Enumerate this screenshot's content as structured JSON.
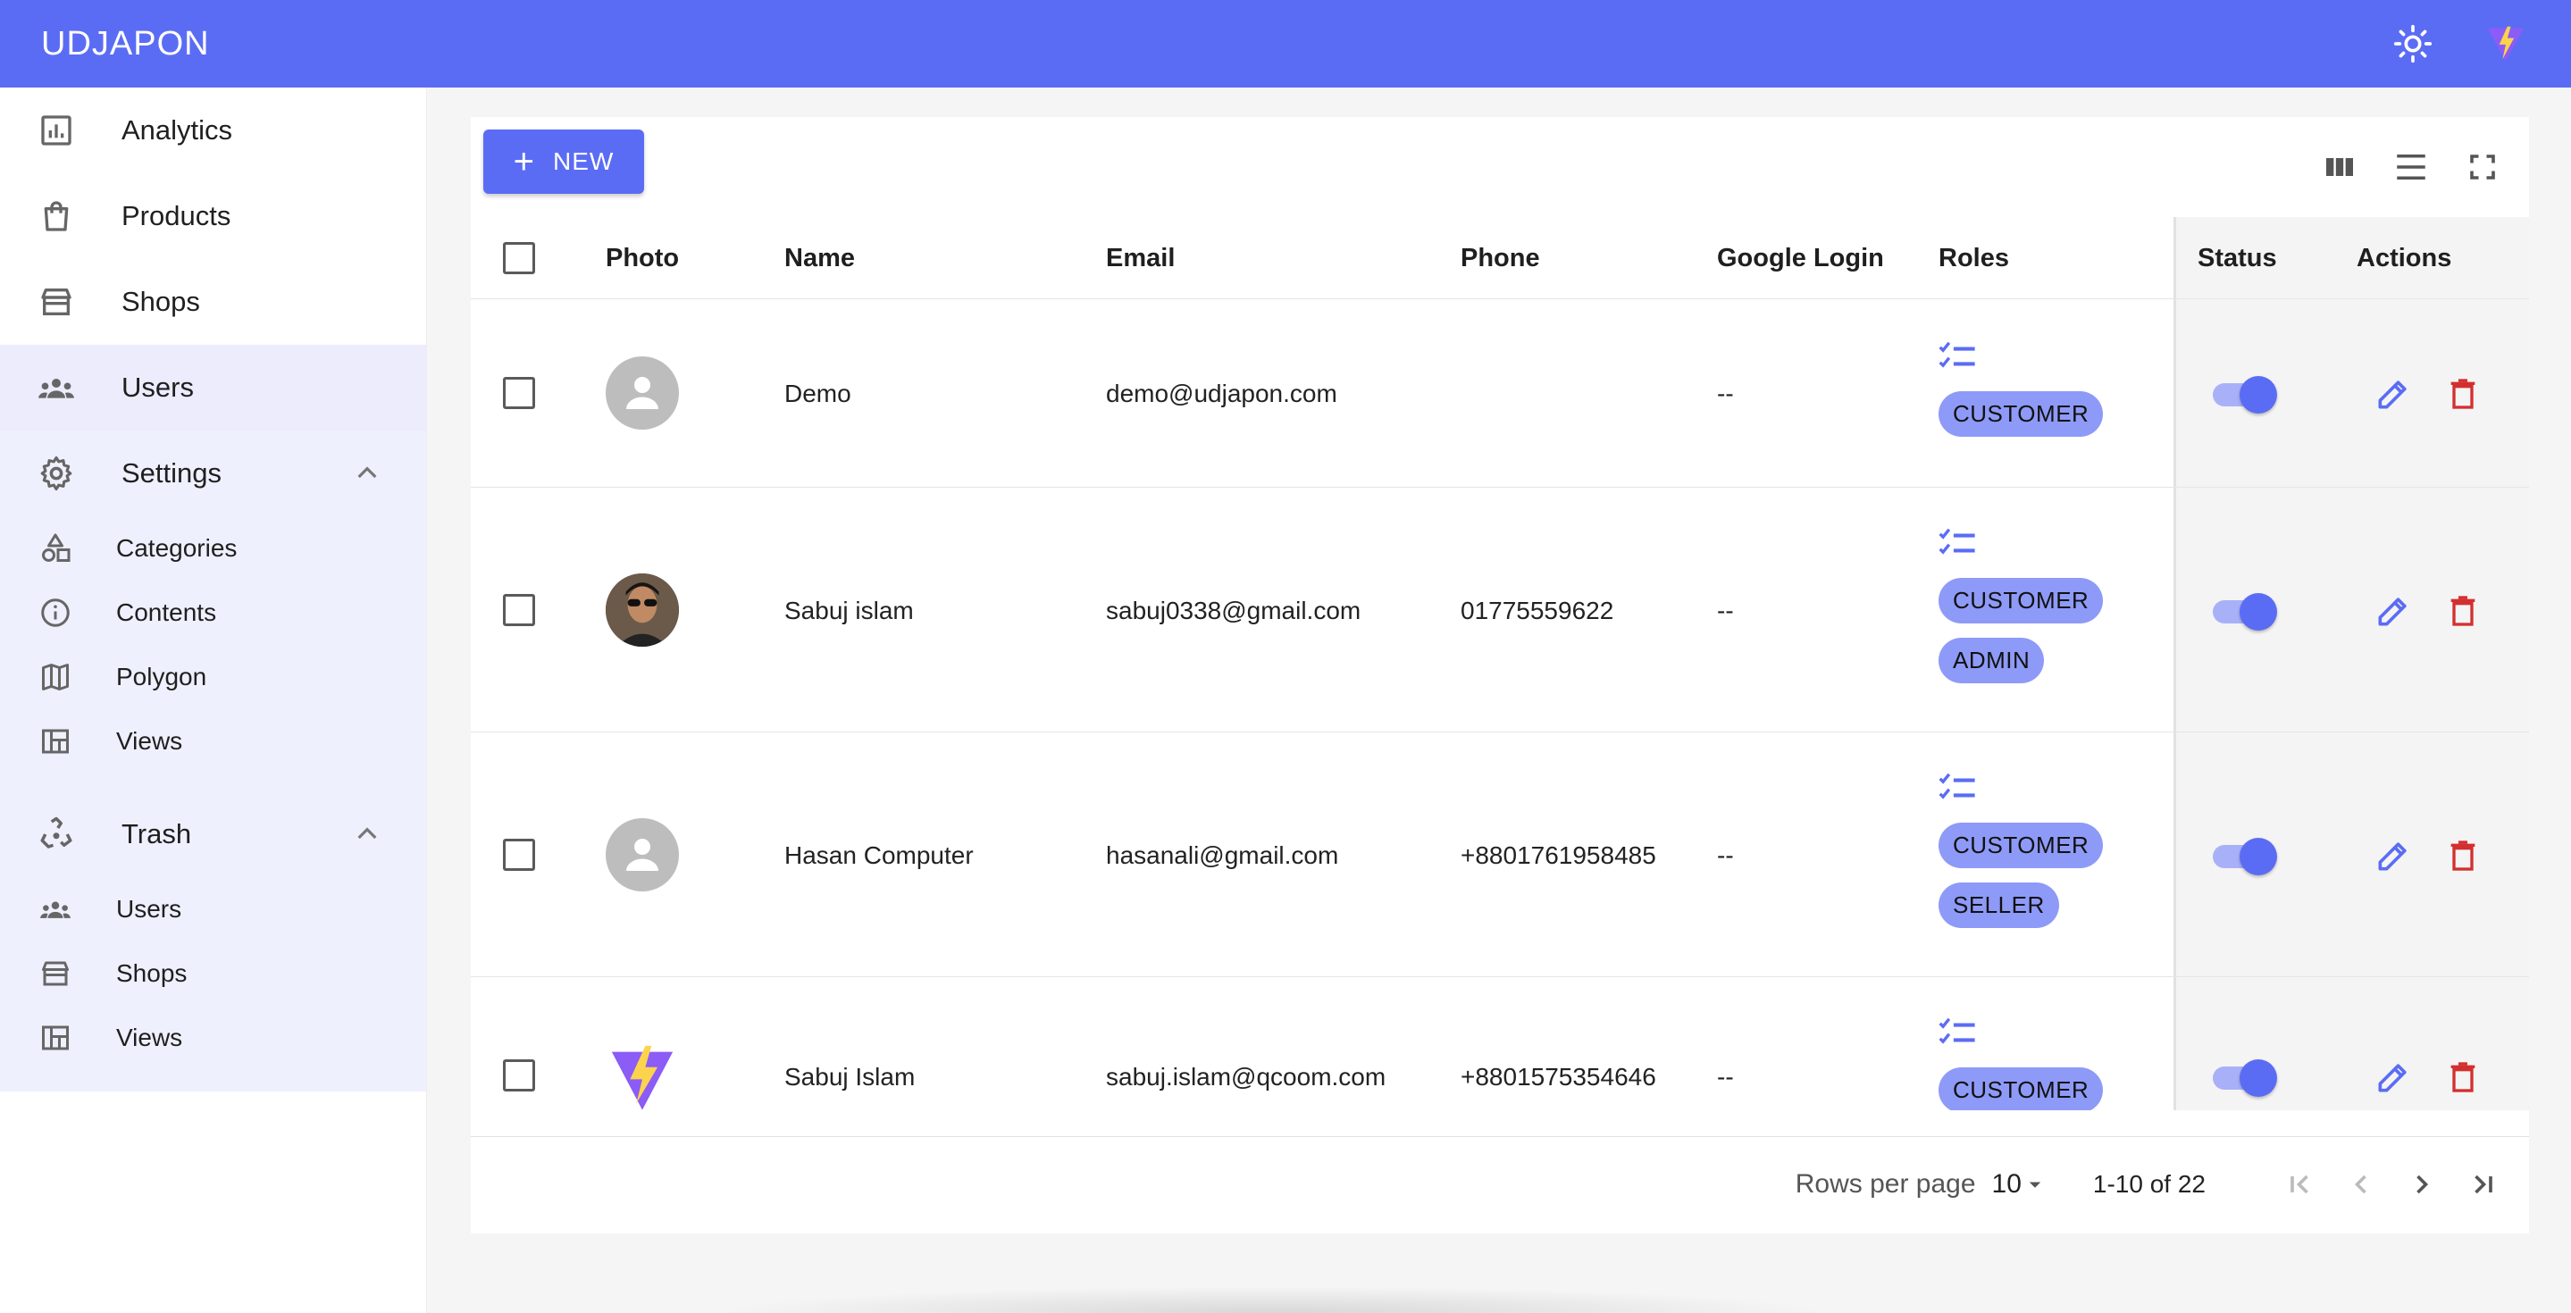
{
  "app": {
    "title": "UDJAPON",
    "header_icons": [
      "sun-icon",
      "vite-logo-icon"
    ],
    "colors": {
      "primary": "#5b6cf4",
      "chip": "#8e9af7",
      "danger": "#d32f2f",
      "sidebar_group_bg": "#eef0fd"
    }
  },
  "sidebar": {
    "items": [
      {
        "label": "Analytics",
        "icon": "analytics-icon"
      },
      {
        "label": "Products",
        "icon": "shopping-bag-icon"
      },
      {
        "label": "Shops",
        "icon": "store-icon"
      },
      {
        "label": "Users",
        "icon": "users-icon"
      }
    ],
    "settings": {
      "label": "Settings",
      "icon": "gear-icon",
      "expanded": true,
      "children": [
        {
          "label": "Categories",
          "icon": "categories-icon"
        },
        {
          "label": "Contents",
          "icon": "info-icon"
        },
        {
          "label": "Polygon",
          "icon": "map-icon"
        },
        {
          "label": "Views",
          "icon": "view-quilt-icon"
        }
      ]
    },
    "trash": {
      "label": "Trash",
      "icon": "recycle-icon",
      "expanded": true,
      "children": [
        {
          "label": "Users",
          "icon": "users-icon"
        },
        {
          "label": "Shops",
          "icon": "store-icon"
        },
        {
          "label": "Views",
          "icon": "view-quilt-icon"
        }
      ]
    }
  },
  "toolbar": {
    "new_label": "NEW",
    "tools": [
      "columns-icon",
      "density-icon",
      "fullscreen-icon"
    ]
  },
  "table": {
    "columns": [
      "Photo",
      "Name",
      "Email",
      "Phone",
      "Google Login",
      "Roles",
      "Status",
      "Actions"
    ],
    "rows": [
      {
        "name": "Demo",
        "email": "demo@udjapon.com",
        "phone": "",
        "google_login": "--",
        "roles": [
          "CUSTOMER"
        ],
        "status": true,
        "photo": "default"
      },
      {
        "name": "Sabuj islam",
        "email": "sabuj0338@gmail.com",
        "phone": "01775559622",
        "google_login": "--",
        "roles": [
          "CUSTOMER",
          "ADMIN"
        ],
        "status": true,
        "photo": "person"
      },
      {
        "name": "Hasan Computer",
        "email": "hasanali@gmail.com",
        "phone": "+8801761958485",
        "google_login": "--",
        "roles": [
          "CUSTOMER",
          "SELLER"
        ],
        "status": true,
        "photo": "default"
      },
      {
        "name": "Sabuj Islam",
        "email": "sabuj.islam@qcoom.com",
        "phone": "+8801575354646",
        "google_login": "--",
        "roles": [
          "CUSTOMER"
        ],
        "status": true,
        "photo": "vite-logo"
      }
    ]
  },
  "pagination": {
    "rows_per_page_label": "Rows per page",
    "rows_per_page": "10",
    "range": "1-10 of 22"
  }
}
